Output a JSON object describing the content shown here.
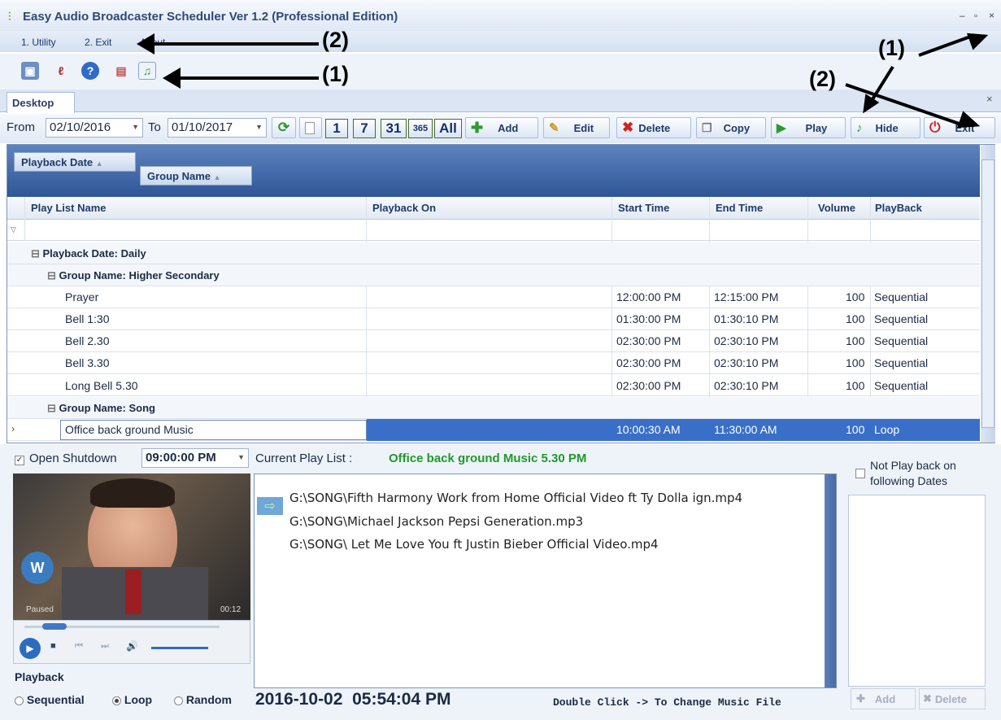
{
  "app": {
    "title": "Easy Audio Broadcaster Scheduler Ver 1.2 (Professional Edition)"
  },
  "menu": {
    "items": [
      "1. Utility",
      "2. Exit",
      "About"
    ]
  },
  "tabs": {
    "desktop": "Desktop"
  },
  "toolbar": {
    "from_label": "From",
    "from_date": "02/10/2016",
    "to_label": "To",
    "to_date": "01/10/2017",
    "day_buttons": [
      "1",
      "7",
      "31",
      "365",
      "All"
    ],
    "add": "Add",
    "edit": "Edit",
    "delete": "Delete",
    "copy": "Copy",
    "play": "Play",
    "hide": "Hide",
    "exit": "Exit"
  },
  "grid": {
    "group_chips": [
      "Playback Date",
      "Group Name"
    ],
    "columns": [
      "Play List Name",
      "Playback On",
      "Start Time",
      "End Time",
      "Volume",
      "PlayBack"
    ],
    "group_date": "Playback Date: Daily",
    "group1": "Group Name: Higher Secondary",
    "group2": "Group Name: Song",
    "rows": [
      {
        "name": "Prayer",
        "start": "12:00:00 PM",
        "end": "12:15:00 PM",
        "volume": "100",
        "playback": "Sequential"
      },
      {
        "name": "Bell 1:30",
        "start": "01:30:00 PM",
        "end": "01:30:10 PM",
        "volume": "100",
        "playback": "Sequential"
      },
      {
        "name": "Bell 2.30",
        "start": "02:30:00 PM",
        "end": "02:30:10 PM",
        "volume": "100",
        "playback": "Sequential"
      },
      {
        "name": "Bell 3.30",
        "start": "02:30:00 PM",
        "end": "02:30:10 PM",
        "volume": "100",
        "playback": "Sequential"
      },
      {
        "name": "Long Bell 5.30",
        "start": "02:30:00 PM",
        "end": "02:30:10 PM",
        "volume": "100",
        "playback": "Sequential"
      }
    ],
    "selected": {
      "name": "Office back ground Music",
      "start": "10:00:30 AM",
      "end": "11:30:00 AM",
      "volume": "100",
      "playback": "Loop"
    }
  },
  "bottom": {
    "open_shutdown": "Open Shutdown",
    "shutdown_time": "09:00:00 PM",
    "current_label": "Current Play List :",
    "current_value": "Office back ground Music 5.30 PM",
    "files": [
      "G:\\SONG\\Fifth Harmony Work from Home Official Video ft Ty Dolla ign.mp4",
      "G:\\SONG\\Michael Jackson Pepsi Generation.mp3",
      "G:\\SONG\\ Let Me Love You ft Justin Bieber Official Video.mp4"
    ],
    "not_play": "Not Play back on following Dates",
    "player_status": "Paused",
    "player_time": "00:12",
    "playback_label": "Playback",
    "modes": [
      "Sequential",
      "Loop",
      "Random"
    ],
    "datetime": "2016-10-02  05:54:04 PM",
    "hint": "Double Click -> To Change Music File",
    "add": "Add",
    "delete": "Delete"
  },
  "annotations": {
    "one": "(1)",
    "two": "(2)"
  }
}
